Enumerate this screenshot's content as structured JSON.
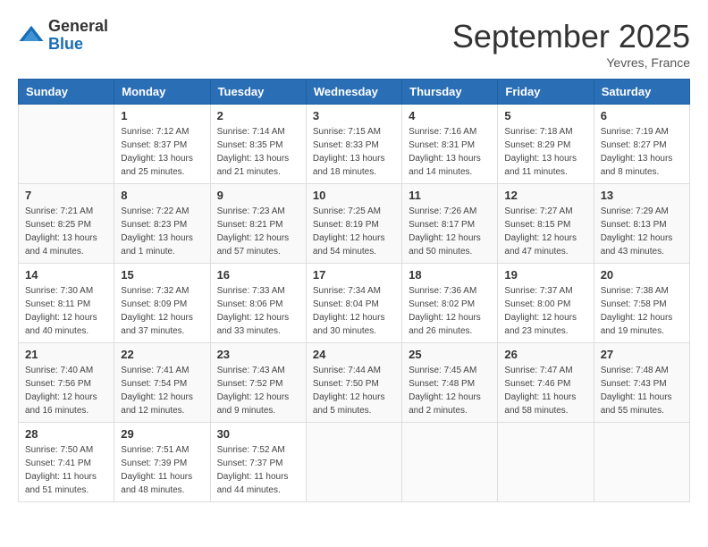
{
  "logo": {
    "general": "General",
    "blue": "Blue"
  },
  "header": {
    "month": "September 2025",
    "location": "Yevres, France"
  },
  "weekdays": [
    "Sunday",
    "Monday",
    "Tuesday",
    "Wednesday",
    "Thursday",
    "Friday",
    "Saturday"
  ],
  "weeks": [
    [
      {
        "day": "",
        "sunrise": "",
        "sunset": "",
        "daylight": ""
      },
      {
        "day": "1",
        "sunrise": "Sunrise: 7:12 AM",
        "sunset": "Sunset: 8:37 PM",
        "daylight": "Daylight: 13 hours and 25 minutes."
      },
      {
        "day": "2",
        "sunrise": "Sunrise: 7:14 AM",
        "sunset": "Sunset: 8:35 PM",
        "daylight": "Daylight: 13 hours and 21 minutes."
      },
      {
        "day": "3",
        "sunrise": "Sunrise: 7:15 AM",
        "sunset": "Sunset: 8:33 PM",
        "daylight": "Daylight: 13 hours and 18 minutes."
      },
      {
        "day": "4",
        "sunrise": "Sunrise: 7:16 AM",
        "sunset": "Sunset: 8:31 PM",
        "daylight": "Daylight: 13 hours and 14 minutes."
      },
      {
        "day": "5",
        "sunrise": "Sunrise: 7:18 AM",
        "sunset": "Sunset: 8:29 PM",
        "daylight": "Daylight: 13 hours and 11 minutes."
      },
      {
        "day": "6",
        "sunrise": "Sunrise: 7:19 AM",
        "sunset": "Sunset: 8:27 PM",
        "daylight": "Daylight: 13 hours and 8 minutes."
      }
    ],
    [
      {
        "day": "7",
        "sunrise": "Sunrise: 7:21 AM",
        "sunset": "Sunset: 8:25 PM",
        "daylight": "Daylight: 13 hours and 4 minutes."
      },
      {
        "day": "8",
        "sunrise": "Sunrise: 7:22 AM",
        "sunset": "Sunset: 8:23 PM",
        "daylight": "Daylight: 13 hours and 1 minute."
      },
      {
        "day": "9",
        "sunrise": "Sunrise: 7:23 AM",
        "sunset": "Sunset: 8:21 PM",
        "daylight": "Daylight: 12 hours and 57 minutes."
      },
      {
        "day": "10",
        "sunrise": "Sunrise: 7:25 AM",
        "sunset": "Sunset: 8:19 PM",
        "daylight": "Daylight: 12 hours and 54 minutes."
      },
      {
        "day": "11",
        "sunrise": "Sunrise: 7:26 AM",
        "sunset": "Sunset: 8:17 PM",
        "daylight": "Daylight: 12 hours and 50 minutes."
      },
      {
        "day": "12",
        "sunrise": "Sunrise: 7:27 AM",
        "sunset": "Sunset: 8:15 PM",
        "daylight": "Daylight: 12 hours and 47 minutes."
      },
      {
        "day": "13",
        "sunrise": "Sunrise: 7:29 AM",
        "sunset": "Sunset: 8:13 PM",
        "daylight": "Daylight: 12 hours and 43 minutes."
      }
    ],
    [
      {
        "day": "14",
        "sunrise": "Sunrise: 7:30 AM",
        "sunset": "Sunset: 8:11 PM",
        "daylight": "Daylight: 12 hours and 40 minutes."
      },
      {
        "day": "15",
        "sunrise": "Sunrise: 7:32 AM",
        "sunset": "Sunset: 8:09 PM",
        "daylight": "Daylight: 12 hours and 37 minutes."
      },
      {
        "day": "16",
        "sunrise": "Sunrise: 7:33 AM",
        "sunset": "Sunset: 8:06 PM",
        "daylight": "Daylight: 12 hours and 33 minutes."
      },
      {
        "day": "17",
        "sunrise": "Sunrise: 7:34 AM",
        "sunset": "Sunset: 8:04 PM",
        "daylight": "Daylight: 12 hours and 30 minutes."
      },
      {
        "day": "18",
        "sunrise": "Sunrise: 7:36 AM",
        "sunset": "Sunset: 8:02 PM",
        "daylight": "Daylight: 12 hours and 26 minutes."
      },
      {
        "day": "19",
        "sunrise": "Sunrise: 7:37 AM",
        "sunset": "Sunset: 8:00 PM",
        "daylight": "Daylight: 12 hours and 23 minutes."
      },
      {
        "day": "20",
        "sunrise": "Sunrise: 7:38 AM",
        "sunset": "Sunset: 7:58 PM",
        "daylight": "Daylight: 12 hours and 19 minutes."
      }
    ],
    [
      {
        "day": "21",
        "sunrise": "Sunrise: 7:40 AM",
        "sunset": "Sunset: 7:56 PM",
        "daylight": "Daylight: 12 hours and 16 minutes."
      },
      {
        "day": "22",
        "sunrise": "Sunrise: 7:41 AM",
        "sunset": "Sunset: 7:54 PM",
        "daylight": "Daylight: 12 hours and 12 minutes."
      },
      {
        "day": "23",
        "sunrise": "Sunrise: 7:43 AM",
        "sunset": "Sunset: 7:52 PM",
        "daylight": "Daylight: 12 hours and 9 minutes."
      },
      {
        "day": "24",
        "sunrise": "Sunrise: 7:44 AM",
        "sunset": "Sunset: 7:50 PM",
        "daylight": "Daylight: 12 hours and 5 minutes."
      },
      {
        "day": "25",
        "sunrise": "Sunrise: 7:45 AM",
        "sunset": "Sunset: 7:48 PM",
        "daylight": "Daylight: 12 hours and 2 minutes."
      },
      {
        "day": "26",
        "sunrise": "Sunrise: 7:47 AM",
        "sunset": "Sunset: 7:46 PM",
        "daylight": "Daylight: 11 hours and 58 minutes."
      },
      {
        "day": "27",
        "sunrise": "Sunrise: 7:48 AM",
        "sunset": "Sunset: 7:43 PM",
        "daylight": "Daylight: 11 hours and 55 minutes."
      }
    ],
    [
      {
        "day": "28",
        "sunrise": "Sunrise: 7:50 AM",
        "sunset": "Sunset: 7:41 PM",
        "daylight": "Daylight: 11 hours and 51 minutes."
      },
      {
        "day": "29",
        "sunrise": "Sunrise: 7:51 AM",
        "sunset": "Sunset: 7:39 PM",
        "daylight": "Daylight: 11 hours and 48 minutes."
      },
      {
        "day": "30",
        "sunrise": "Sunrise: 7:52 AM",
        "sunset": "Sunset: 7:37 PM",
        "daylight": "Daylight: 11 hours and 44 minutes."
      },
      {
        "day": "",
        "sunrise": "",
        "sunset": "",
        "daylight": ""
      },
      {
        "day": "",
        "sunrise": "",
        "sunset": "",
        "daylight": ""
      },
      {
        "day": "",
        "sunrise": "",
        "sunset": "",
        "daylight": ""
      },
      {
        "day": "",
        "sunrise": "",
        "sunset": "",
        "daylight": ""
      }
    ]
  ]
}
